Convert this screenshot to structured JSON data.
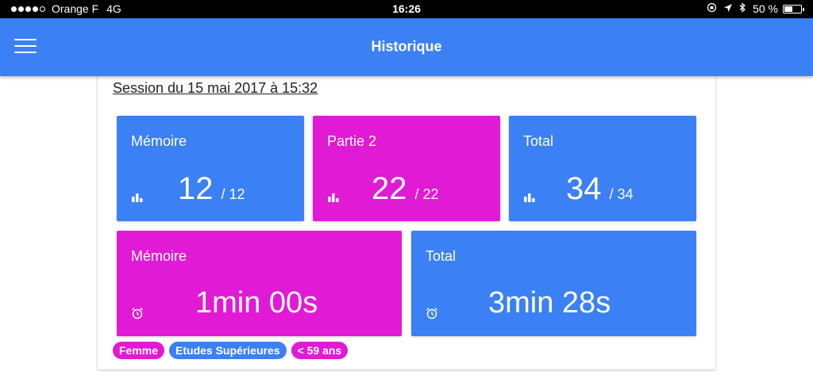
{
  "status_bar": {
    "carrier": "Orange F",
    "network": "4G",
    "time": "16:26",
    "battery": "50 %",
    "battery_level": 0.5,
    "signal_bars_filled": 4,
    "signal_bars_total": 5,
    "icons": [
      "orientation-lock-icon",
      "location-icon",
      "bluetooth-icon"
    ]
  },
  "header": {
    "title": "Historique",
    "menu_icon": "hamburger-menu-icon"
  },
  "session": {
    "title": "Session du 15 mai 2017 à 15:32"
  },
  "score_tiles": [
    {
      "label": "Mémoire",
      "value": "12",
      "total": "/ 12",
      "color": "#3b80f4",
      "icon": "bar-chart-icon"
    },
    {
      "label": "Partie 2",
      "value": "22",
      "total": "/ 22",
      "color": "#e11ad5",
      "icon": "bar-chart-icon"
    },
    {
      "label": "Total",
      "value": "34",
      "total": "/ 34",
      "color": "#3b80f4",
      "icon": "bar-chart-icon"
    }
  ],
  "time_tiles": [
    {
      "label": "Mémoire",
      "value": "1min 00s",
      "color": "#e11ad5",
      "icon": "alarm-clock-icon"
    },
    {
      "label": "Total",
      "value": "3min 28s",
      "color": "#3b80f4",
      "icon": "alarm-clock-icon"
    }
  ],
  "tags": [
    {
      "label": "Femme",
      "color": "#e11ad5"
    },
    {
      "label": "Etudes Supérieures",
      "color": "#3b80f4"
    },
    {
      "label": "< 59 ans",
      "color": "#e11ad5"
    }
  ],
  "colors": {
    "primary": "#3b80f4",
    "accent": "#e11ad5"
  }
}
